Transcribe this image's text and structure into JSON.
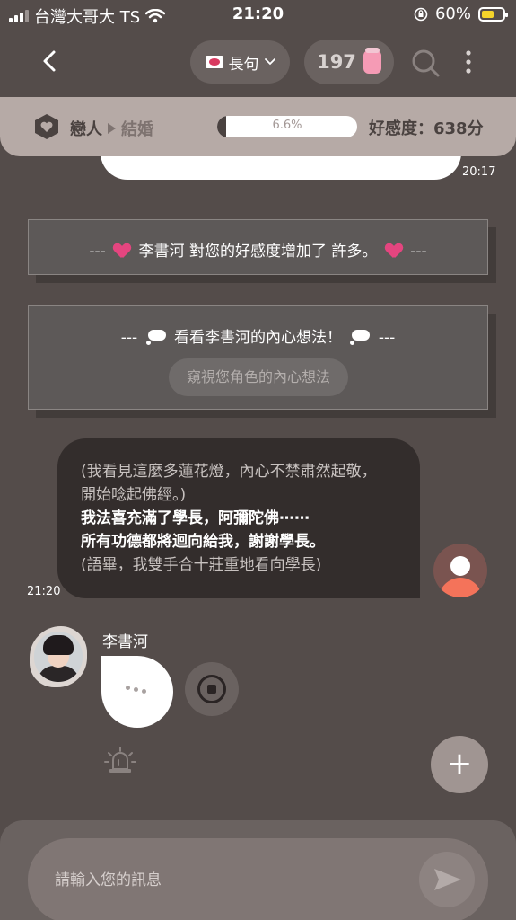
{
  "status_bar": {
    "carrier": "台灣大哥大 TS",
    "time": "21:20",
    "battery": "60%",
    "battery_color": "#f5d42a"
  },
  "header": {
    "mode_label": "長句",
    "mode_icon": "envelope-heart-icon",
    "count": "197",
    "count_icon": "jar-icon"
  },
  "affinity": {
    "relationship_current": "戀人",
    "relationship_next": "結婚",
    "progress_percent": 6.6,
    "progress_label": "6.6%",
    "score_label": "好感度：638分"
  },
  "messages": {
    "prev_time": "20:17",
    "system_affinity": {
      "prefix": "---",
      "text": "李書河 對您的好感度增加了 許多。",
      "suffix": "---"
    },
    "system_thoughts": {
      "prefix": "---",
      "text": "看看李書河的內心想法！",
      "suffix": "---",
      "button": "窺視您角色的內心想法"
    },
    "user_message": {
      "lines": [
        "(我看見這麼多蓮花燈，內心不禁肅然起敬，",
        "開始唸起佛經。)",
        "我法喜充滿了學長，阿彌陀佛⋯⋯",
        "所有功德都將迴向給我，謝謝學長。",
        "(語畢，我雙手合十莊重地看向學長)"
      ],
      "time": "21:20"
    },
    "character": {
      "name": "李書河"
    }
  },
  "composer": {
    "placeholder": "請輸入您的訊息"
  },
  "colors": {
    "background": "#544c4a",
    "affinity_bar": "#b6aaa6",
    "heart": "#e4457f",
    "user_avatar": "#f4735a"
  }
}
